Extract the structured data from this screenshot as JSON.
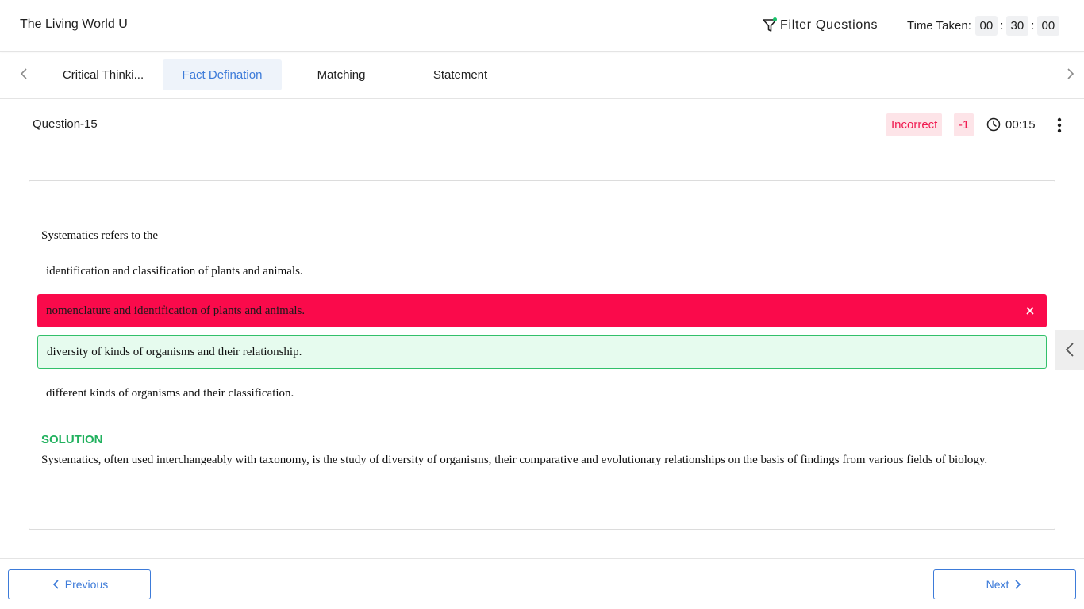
{
  "header": {
    "title": "The Living World U",
    "filter_label": "Filter Questions",
    "time_label": "Time Taken:",
    "time": {
      "hours": "00",
      "minutes": "30",
      "seconds": "00"
    }
  },
  "tabs": [
    {
      "label": "Critical Thinki...",
      "active": false
    },
    {
      "label": "Fact Defination",
      "active": true
    },
    {
      "label": "Matching",
      "active": false
    },
    {
      "label": "Statement",
      "active": false
    }
  ],
  "question": {
    "title": "Question-15",
    "status": "Incorrect",
    "score": "-1",
    "time": "00:15",
    "text": "Systematics refers to the",
    "options": [
      {
        "text": "identification and classification of plants and animals.",
        "state": "none"
      },
      {
        "text": "nomenclature and identification of plants and animals.",
        "state": "wrong"
      },
      {
        "text": "diversity of kinds of organisms and their relationship.",
        "state": "correct"
      },
      {
        "text": "different kinds of organisms and their classification.",
        "state": "none"
      }
    ],
    "solution_title": "SOLUTION",
    "solution_text": "Systematics, often used interchangeably with taxonomy, is the study of diversity of organisms, their comparative and evolutionary relationships on the basis of findings from various fields of biology."
  },
  "footer": {
    "previous_label": "Previous",
    "next_label": "Next"
  },
  "colors": {
    "accent": "#3d7bd9",
    "incorrect": "#fa0a4b",
    "correct_bg": "#e6fbee",
    "correct_border": "#32c06a",
    "solution": "#21b15e"
  }
}
